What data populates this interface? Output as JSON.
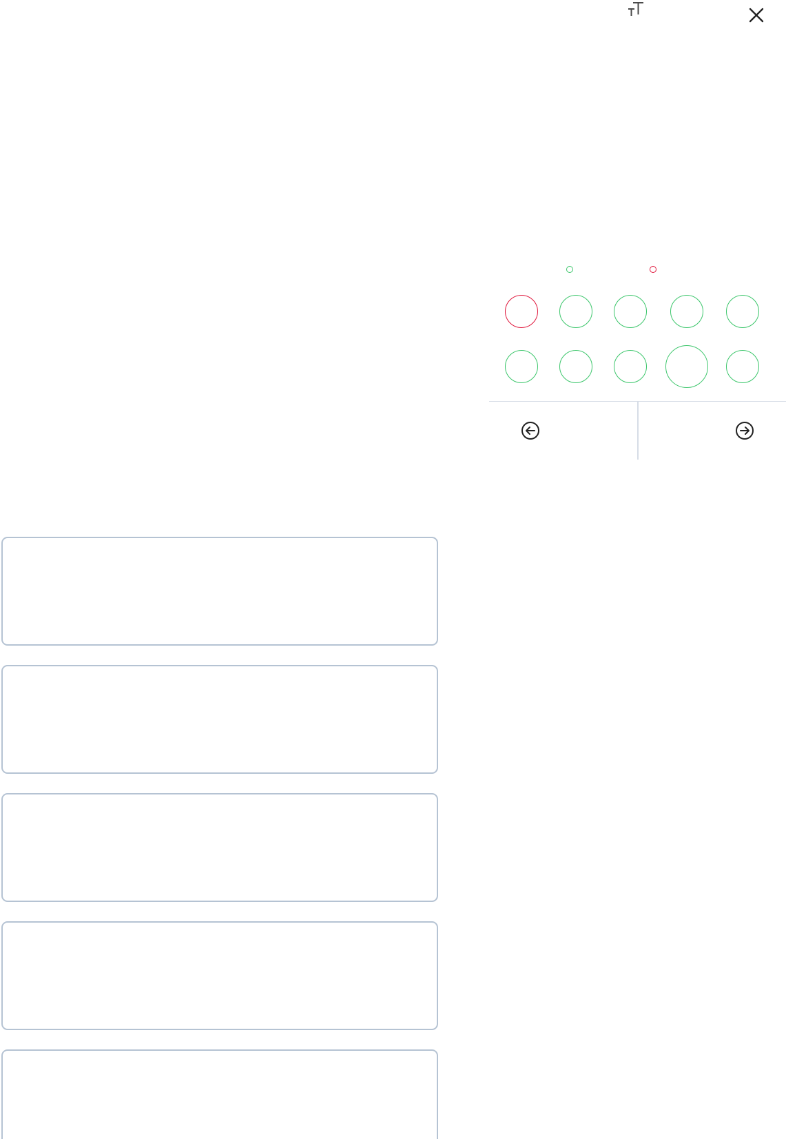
{
  "toolbar": {
    "font_size_icon": "font-size-icon",
    "close_icon": "close-icon"
  },
  "legend": {
    "answered_color": "#3cc66b",
    "flagged_color": "#e0183d"
  },
  "question_map": {
    "questions": [
      {
        "status": "flagged"
      },
      {
        "status": "answered"
      },
      {
        "status": "answered"
      },
      {
        "status": "answered"
      },
      {
        "status": "answered"
      },
      {
        "status": "answered"
      },
      {
        "status": "answered"
      },
      {
        "status": "answered"
      },
      {
        "status": "answered",
        "current": true
      },
      {
        "status": "answered"
      }
    ]
  },
  "navigation": {
    "prev_icon": "arrow-left-circle-icon",
    "next_icon": "arrow-right-circle-icon"
  },
  "answers": {
    "options": [
      "",
      "",
      "",
      "",
      ""
    ]
  },
  "colors": {
    "box_border": "#b5c3d3",
    "divider": "#d6dde6",
    "icon": "#333333"
  }
}
